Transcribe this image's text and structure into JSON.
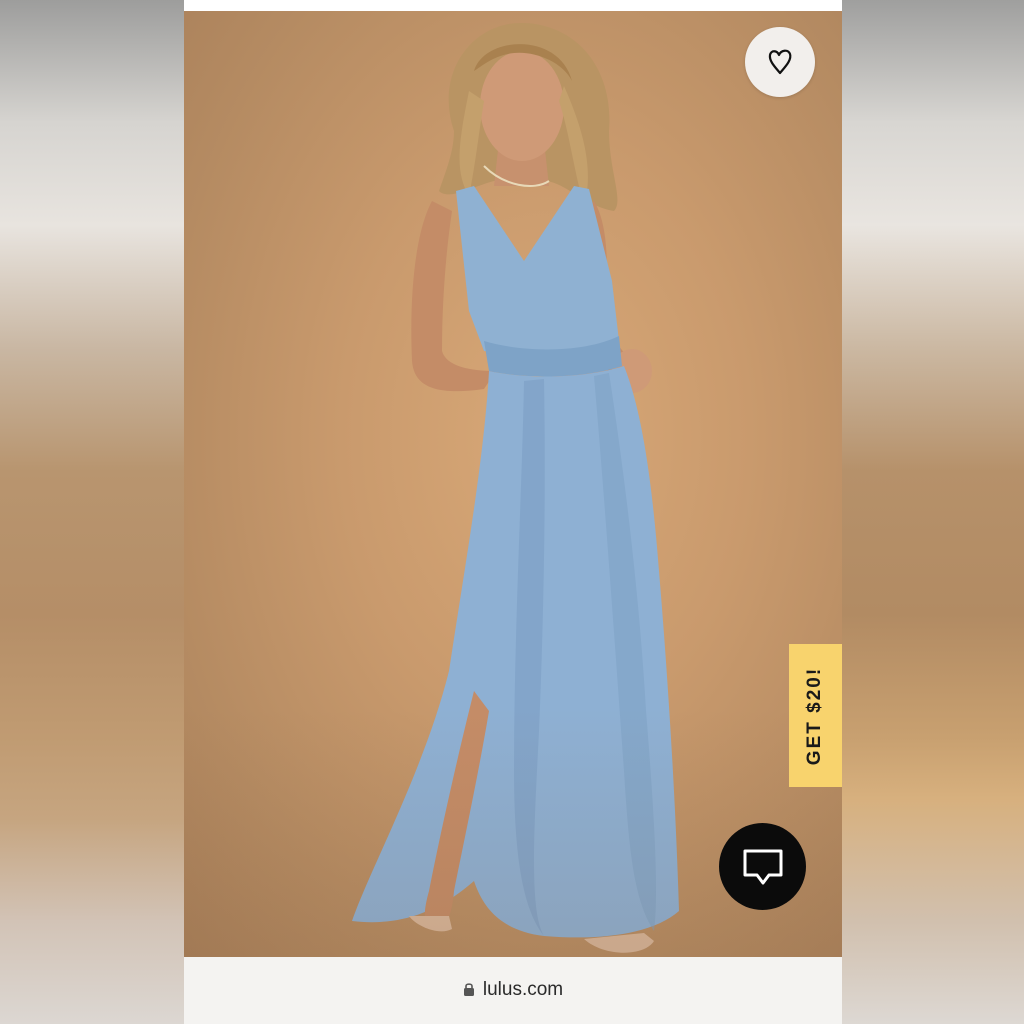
{
  "product": {
    "image_alt": "Model wearing light blue maxi dress"
  },
  "favorite": {
    "icon": "heart-icon"
  },
  "promo": {
    "label": "GET $20!",
    "color": "#f8d36d"
  },
  "chat": {
    "icon": "chat-bubble-icon"
  },
  "browser": {
    "url": "lulus.com",
    "lock_icon": "lock-icon"
  }
}
